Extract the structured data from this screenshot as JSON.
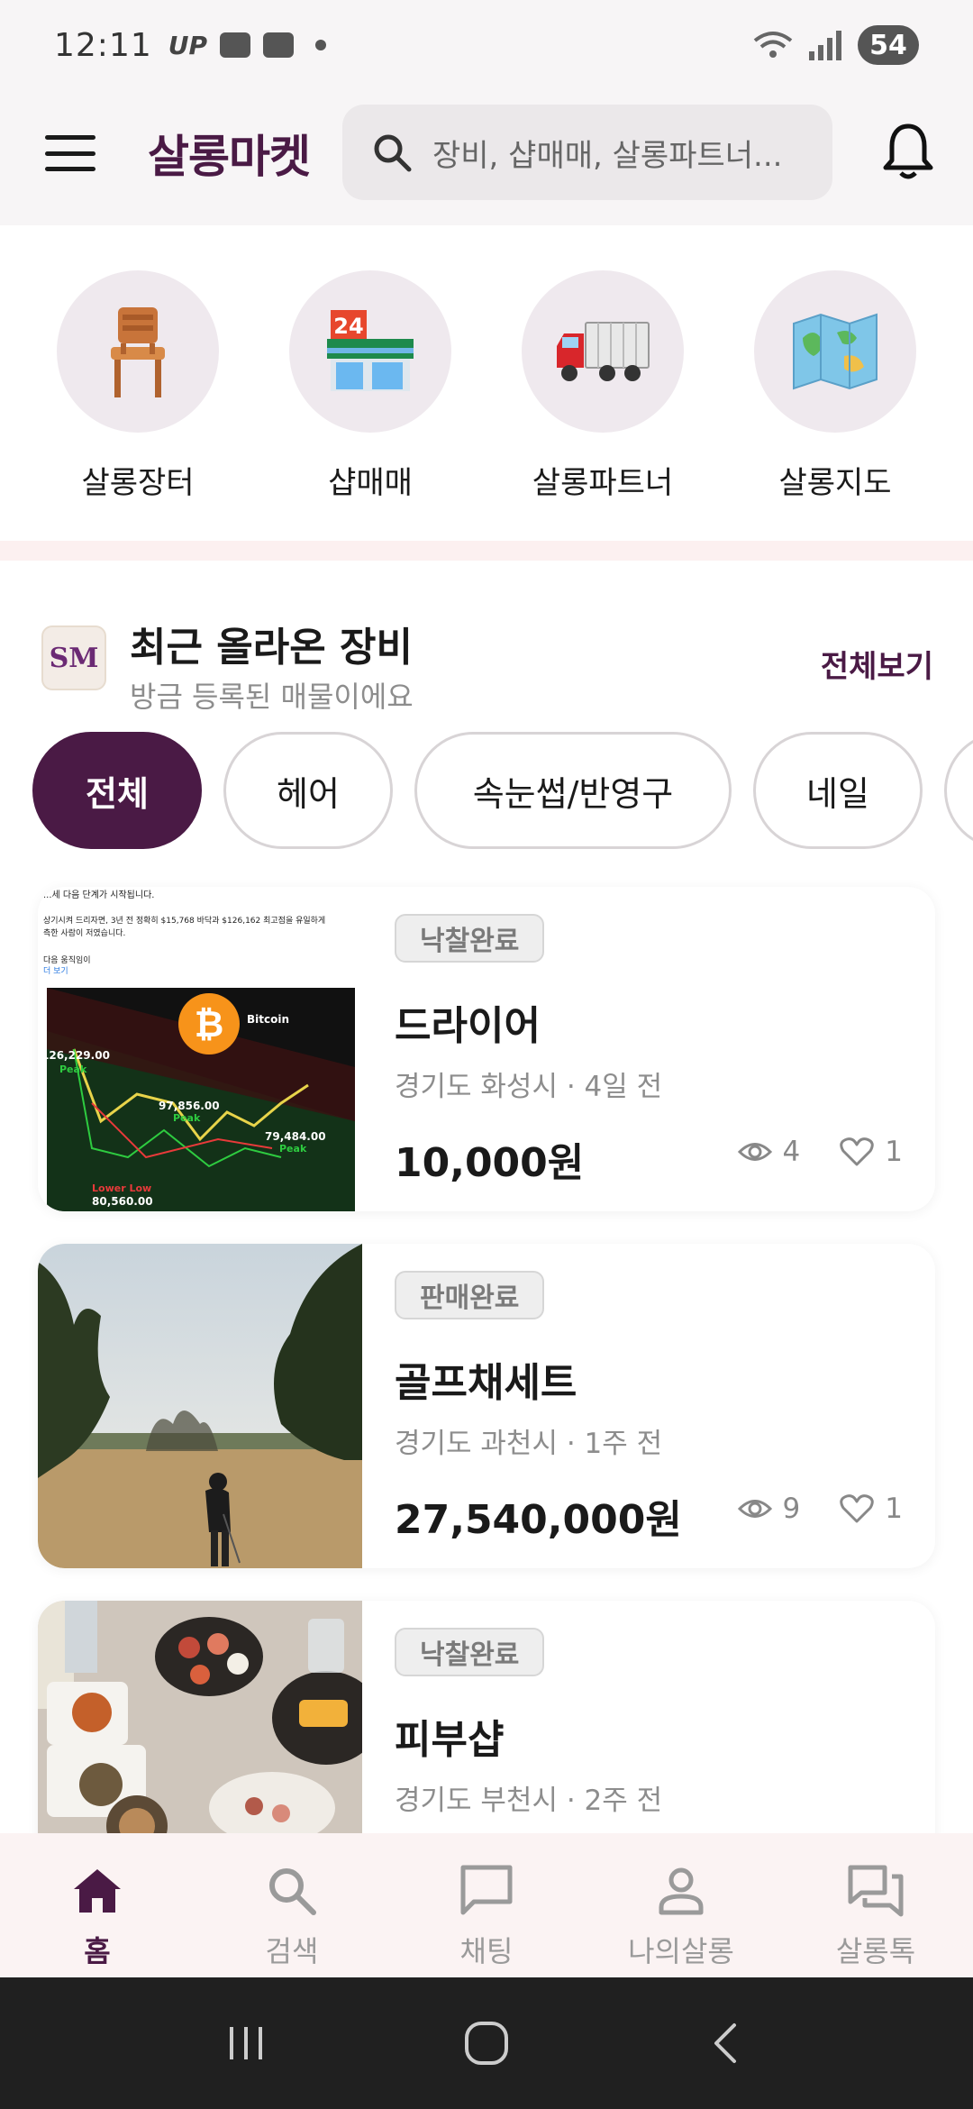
{
  "status": {
    "time": "12:11",
    "mini_text": "UP",
    "battery": "54"
  },
  "header": {
    "brand": "살롱마켓",
    "search_placeholder": "장비, 샵매매, 살롱파트너..."
  },
  "categories": [
    {
      "label": "살롱장터",
      "icon": "chair-icon"
    },
    {
      "label": "샵매매",
      "icon": "store-24-icon"
    },
    {
      "label": "살롱파트너",
      "icon": "truck-icon"
    },
    {
      "label": "살롱지도",
      "icon": "map-icon"
    }
  ],
  "section": {
    "logo": "SM",
    "title": "최근 올라온 장비",
    "subtitle": "방금 등록된 매물이에요",
    "see_all": "전체보기",
    "chips": [
      "전체",
      "헤어",
      "속눈썹/반영구",
      "네일",
      ""
    ],
    "active_chip": "전체"
  },
  "listings": [
    {
      "badge": "낙찰완료",
      "title": "드라이어",
      "location": "경기도 화성시 · 4일 전",
      "price": "10,000원",
      "views": "4",
      "likes": "1",
      "thumb": {
        "line1": "...세 다음 단계가 시작됩니다.",
        "line2": "상기시켜 드리자면, 3년 전 정확히 $15,768 바닥과 $126,162 최고점을 유일하게",
        "line3": "측한 사람이 저였습니다.",
        "line4": "다음 움직임이",
        "more": "더 보기",
        "coin": "Bitcoin",
        "peak1": "126,229.00",
        "peak2": "97,856.00",
        "peak3": "79,484.00",
        "peak_label": "Peak",
        "low_label": "Lower Low",
        "low_value": "80,560.00"
      }
    },
    {
      "badge": "판매완료",
      "title": "골프채세트",
      "location": "경기도 과천시 · 1주 전",
      "price": "27,540,000원",
      "views": "9",
      "likes": "1"
    },
    {
      "badge": "낙찰완료",
      "title": "피부샵",
      "location": "경기도 부천시 · 2주 전",
      "price": "",
      "views": "",
      "likes": ""
    }
  ],
  "nav": [
    {
      "label": "홈",
      "icon": "home-icon",
      "active": true
    },
    {
      "label": "검색",
      "icon": "search-icon",
      "active": false
    },
    {
      "label": "채팅",
      "icon": "chat-icon",
      "active": false
    },
    {
      "label": "나의살롱",
      "icon": "person-icon",
      "active": false
    },
    {
      "label": "살롱톡",
      "icon": "forum-icon",
      "active": false
    }
  ],
  "colors": {
    "brand": "#4a1a45",
    "chip_active": "#4a1a45",
    "nav_bg": "#fbf3f3"
  }
}
